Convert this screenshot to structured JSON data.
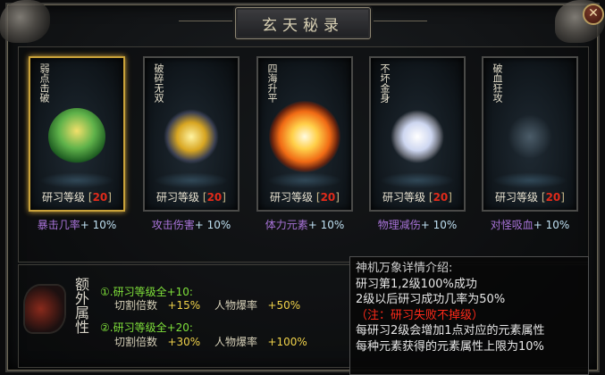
{
  "window": {
    "title": "玄天秘录",
    "close_label": "✕"
  },
  "cards": [
    {
      "name": "弱点击破",
      "icon": "green-gold-vase-icon",
      "level_label": "研习等级",
      "level_value": "20",
      "stat_name": "暴击几率",
      "stat_value": "+ 10%"
    },
    {
      "name": "破碎无双",
      "icon": "golden-shards-icon",
      "level_label": "研习等级",
      "level_value": "20",
      "stat_name": "攻击伤害",
      "stat_value": "+ 10%"
    },
    {
      "name": "四海升平",
      "icon": "fire-orb-icon",
      "level_label": "研习等级",
      "level_value": "20",
      "stat_name": "体力元素",
      "stat_value": "+ 10%"
    },
    {
      "name": "不坏金身",
      "icon": "silver-orb-icon",
      "level_label": "研习等级",
      "level_value": "20",
      "stat_name": "物理减伤",
      "stat_value": "+ 10%"
    },
    {
      "name": "破血狂攻",
      "icon": "mist-icon",
      "level_label": "研习等级",
      "level_value": "20",
      "stat_name": "对怪吸血",
      "stat_value": "+ 10%"
    }
  ],
  "extra": {
    "title": "额外属性",
    "tiers": [
      {
        "head": "①.研习等级全+10:",
        "cut_label": "切割倍数",
        "cut_value": "+15%",
        "drop_label": "人物爆率",
        "drop_value": "+50%"
      },
      {
        "head": "②.研习等级全+20:",
        "cut_label": "切割倍数",
        "cut_value": "+30%",
        "drop_label": "人物爆率",
        "drop_value": "+100%"
      }
    ]
  },
  "tooltip": {
    "title": "神机万象详情介绍:",
    "line1": "研习第1,2级100%成功",
    "line2": "2级以后研习成功几率为50%",
    "warn": "（注：研习失败不掉级）",
    "line3": "每研习2级会增加1点对应的元素属性",
    "line4": "每种元素获得的元素属性上限为10%"
  },
  "colors": {
    "level_value": "#e02a1a",
    "stat_name": "#a873d8",
    "tier_head": "#7fe03a",
    "warn": "#ff2a1a"
  }
}
